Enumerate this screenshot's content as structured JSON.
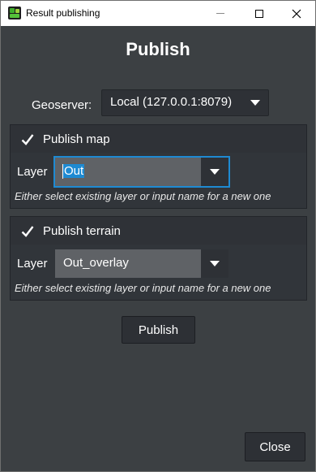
{
  "window": {
    "title": "Result publishing"
  },
  "dialog": {
    "heading": "Publish",
    "geoserver_label": "Geoserver:",
    "geoserver_value": "Local (127.0.0.1:8079)"
  },
  "publish_map": {
    "checked": true,
    "label": "Publish map",
    "layer_label": "Layer",
    "layer_value": "Out",
    "hint": "Either select existing layer or input name for a new one"
  },
  "publish_terrain": {
    "checked": true,
    "label": "Publish terrain",
    "layer_label": "Layer",
    "layer_value": "Out_overlay",
    "hint": "Either select existing layer or input name for a new one"
  },
  "buttons": {
    "publish": "Publish",
    "close": "Close"
  },
  "colors": {
    "background": "#3c4043",
    "accent": "#1e8ad2",
    "field": "#5f6266"
  },
  "icons": {
    "app": "app-logo-icon",
    "minimize": "minimize-icon",
    "maximize": "maximize-icon",
    "close": "close-icon",
    "checkbox": "checkmark-icon",
    "dropdown": "chevron-down-icon"
  }
}
